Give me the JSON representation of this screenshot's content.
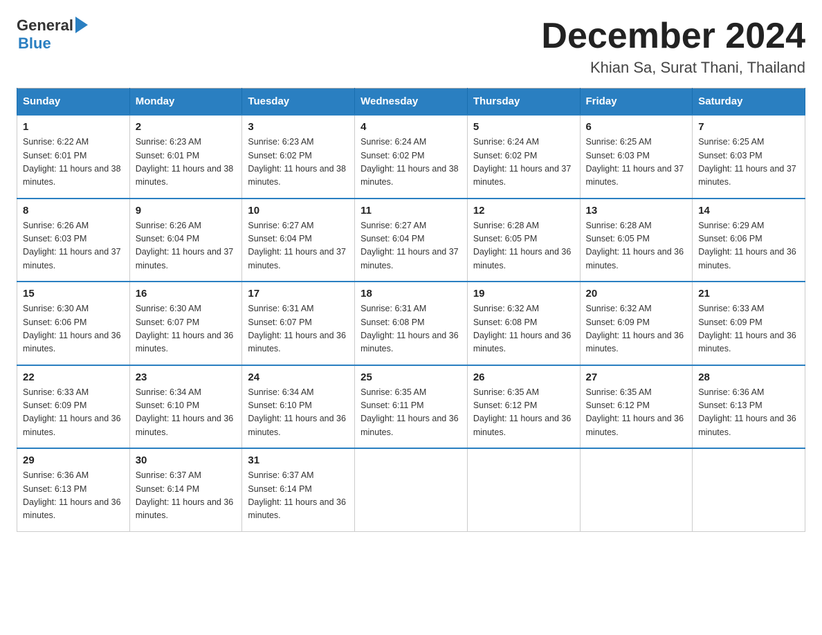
{
  "header": {
    "logo_general": "General",
    "logo_blue": "Blue",
    "month_title": "December 2024",
    "location": "Khian Sa, Surat Thani, Thailand"
  },
  "columns": [
    "Sunday",
    "Monday",
    "Tuesday",
    "Wednesday",
    "Thursday",
    "Friday",
    "Saturday"
  ],
  "weeks": [
    [
      {
        "day": "1",
        "sunrise": "6:22 AM",
        "sunset": "6:01 PM",
        "daylight": "11 hours and 38 minutes."
      },
      {
        "day": "2",
        "sunrise": "6:23 AM",
        "sunset": "6:01 PM",
        "daylight": "11 hours and 38 minutes."
      },
      {
        "day": "3",
        "sunrise": "6:23 AM",
        "sunset": "6:02 PM",
        "daylight": "11 hours and 38 minutes."
      },
      {
        "day": "4",
        "sunrise": "6:24 AM",
        "sunset": "6:02 PM",
        "daylight": "11 hours and 38 minutes."
      },
      {
        "day": "5",
        "sunrise": "6:24 AM",
        "sunset": "6:02 PM",
        "daylight": "11 hours and 37 minutes."
      },
      {
        "day": "6",
        "sunrise": "6:25 AM",
        "sunset": "6:03 PM",
        "daylight": "11 hours and 37 minutes."
      },
      {
        "day": "7",
        "sunrise": "6:25 AM",
        "sunset": "6:03 PM",
        "daylight": "11 hours and 37 minutes."
      }
    ],
    [
      {
        "day": "8",
        "sunrise": "6:26 AM",
        "sunset": "6:03 PM",
        "daylight": "11 hours and 37 minutes."
      },
      {
        "day": "9",
        "sunrise": "6:26 AM",
        "sunset": "6:04 PM",
        "daylight": "11 hours and 37 minutes."
      },
      {
        "day": "10",
        "sunrise": "6:27 AM",
        "sunset": "6:04 PM",
        "daylight": "11 hours and 37 minutes."
      },
      {
        "day": "11",
        "sunrise": "6:27 AM",
        "sunset": "6:04 PM",
        "daylight": "11 hours and 37 minutes."
      },
      {
        "day": "12",
        "sunrise": "6:28 AM",
        "sunset": "6:05 PM",
        "daylight": "11 hours and 36 minutes."
      },
      {
        "day": "13",
        "sunrise": "6:28 AM",
        "sunset": "6:05 PM",
        "daylight": "11 hours and 36 minutes."
      },
      {
        "day": "14",
        "sunrise": "6:29 AM",
        "sunset": "6:06 PM",
        "daylight": "11 hours and 36 minutes."
      }
    ],
    [
      {
        "day": "15",
        "sunrise": "6:30 AM",
        "sunset": "6:06 PM",
        "daylight": "11 hours and 36 minutes."
      },
      {
        "day": "16",
        "sunrise": "6:30 AM",
        "sunset": "6:07 PM",
        "daylight": "11 hours and 36 minutes."
      },
      {
        "day": "17",
        "sunrise": "6:31 AM",
        "sunset": "6:07 PM",
        "daylight": "11 hours and 36 minutes."
      },
      {
        "day": "18",
        "sunrise": "6:31 AM",
        "sunset": "6:08 PM",
        "daylight": "11 hours and 36 minutes."
      },
      {
        "day": "19",
        "sunrise": "6:32 AM",
        "sunset": "6:08 PM",
        "daylight": "11 hours and 36 minutes."
      },
      {
        "day": "20",
        "sunrise": "6:32 AM",
        "sunset": "6:09 PM",
        "daylight": "11 hours and 36 minutes."
      },
      {
        "day": "21",
        "sunrise": "6:33 AM",
        "sunset": "6:09 PM",
        "daylight": "11 hours and 36 minutes."
      }
    ],
    [
      {
        "day": "22",
        "sunrise": "6:33 AM",
        "sunset": "6:09 PM",
        "daylight": "11 hours and 36 minutes."
      },
      {
        "day": "23",
        "sunrise": "6:34 AM",
        "sunset": "6:10 PM",
        "daylight": "11 hours and 36 minutes."
      },
      {
        "day": "24",
        "sunrise": "6:34 AM",
        "sunset": "6:10 PM",
        "daylight": "11 hours and 36 minutes."
      },
      {
        "day": "25",
        "sunrise": "6:35 AM",
        "sunset": "6:11 PM",
        "daylight": "11 hours and 36 minutes."
      },
      {
        "day": "26",
        "sunrise": "6:35 AM",
        "sunset": "6:12 PM",
        "daylight": "11 hours and 36 minutes."
      },
      {
        "day": "27",
        "sunrise": "6:35 AM",
        "sunset": "6:12 PM",
        "daylight": "11 hours and 36 minutes."
      },
      {
        "day": "28",
        "sunrise": "6:36 AM",
        "sunset": "6:13 PM",
        "daylight": "11 hours and 36 minutes."
      }
    ],
    [
      {
        "day": "29",
        "sunrise": "6:36 AM",
        "sunset": "6:13 PM",
        "daylight": "11 hours and 36 minutes."
      },
      {
        "day": "30",
        "sunrise": "6:37 AM",
        "sunset": "6:14 PM",
        "daylight": "11 hours and 36 minutes."
      },
      {
        "day": "31",
        "sunrise": "6:37 AM",
        "sunset": "6:14 PM",
        "daylight": "11 hours and 36 minutes."
      },
      null,
      null,
      null,
      null
    ]
  ],
  "sunrise_label": "Sunrise: ",
  "sunset_label": "Sunset: ",
  "daylight_label": "Daylight: "
}
